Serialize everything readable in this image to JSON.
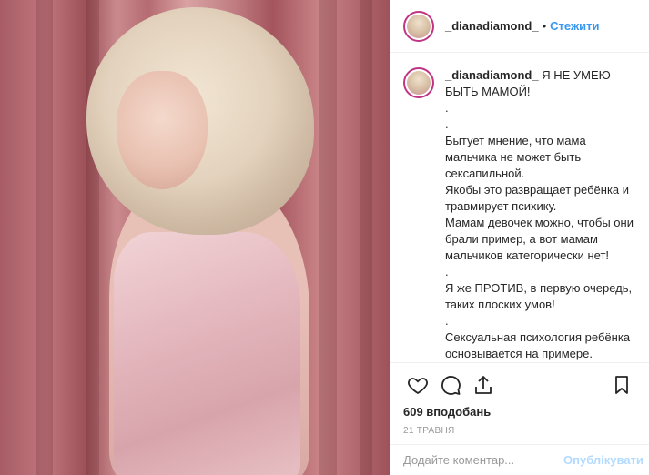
{
  "post": {
    "username": "_dianadiamond_",
    "separator": "•",
    "follow_label": "Стежити",
    "caption_username": "_dianadiamond_",
    "caption_body": " Я НЕ УМЕЮ БЫТЬ МАМОЙ!\n.\n.\nБытует мнение, что мама мальчика не может быть сексапильной.\nЯкобы это развращает ребёнка и травмирует психику.\nМамам девочек можно, чтобы они брали пример, а вот мамам мальчиков категорически нет!\n.\nЯ же ПРОТИВ, в первую очередь, таких плоских умов!\n.\nСексуальная психология ребёнка основывается на примере.\nСын видит, как выглядит красивая, ухоженная,сексапильная женщина и потом вырастая понимает где",
    "likes_text": "609 вподобань",
    "date_text": "21 ТРАВНЯ"
  },
  "comment": {
    "placeholder": "Додайте коментар...",
    "publish_label": "Опублікувати"
  },
  "icons": {
    "like": "heart-icon",
    "comment": "comment-icon",
    "share": "share-icon",
    "save": "bookmark-icon"
  },
  "colors": {
    "link": "#3897f0",
    "publish_disabled": "#b3dbff",
    "story_ring": "#c13584"
  }
}
